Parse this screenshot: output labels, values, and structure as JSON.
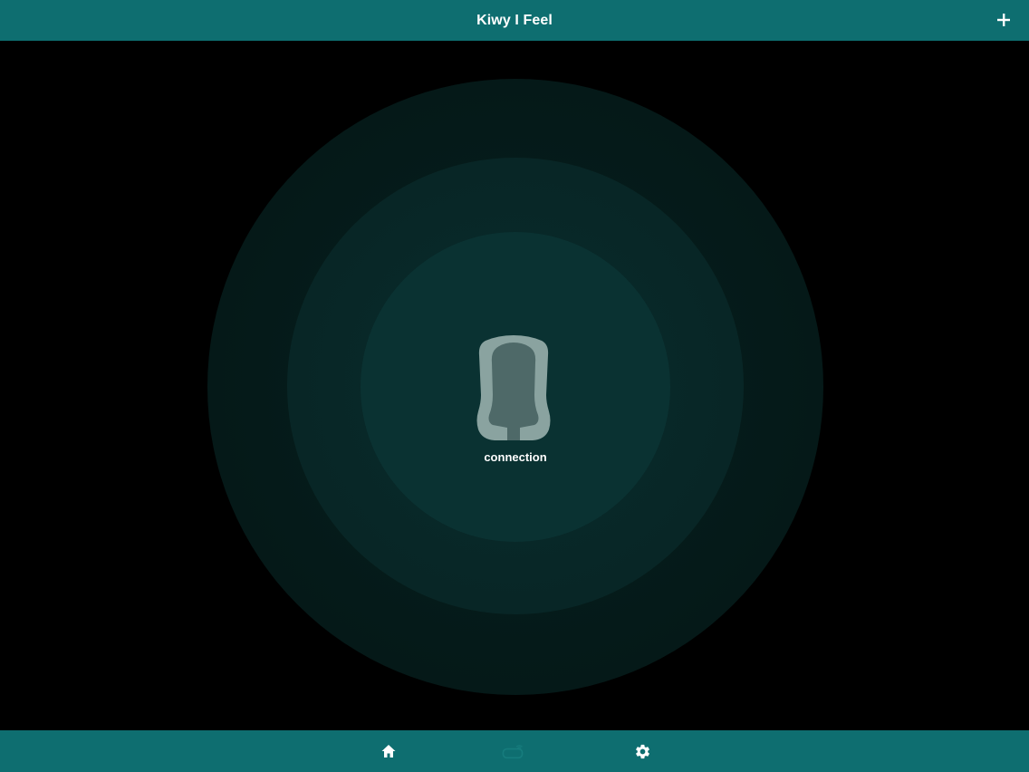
{
  "header": {
    "title": "Kiwy I Feel"
  },
  "main": {
    "status_label": "connection"
  },
  "icons": {
    "add": "plus-icon",
    "seat": "car-seat-icon",
    "home": "home-icon",
    "sensor": "sensor-icon",
    "settings": "gear-icon"
  },
  "colors": {
    "bar": "#0e6e70",
    "background": "#000000",
    "ring_inner": "#0a3232",
    "seat_outline": "#8aa3a0",
    "seat_inner": "#4e6968"
  }
}
